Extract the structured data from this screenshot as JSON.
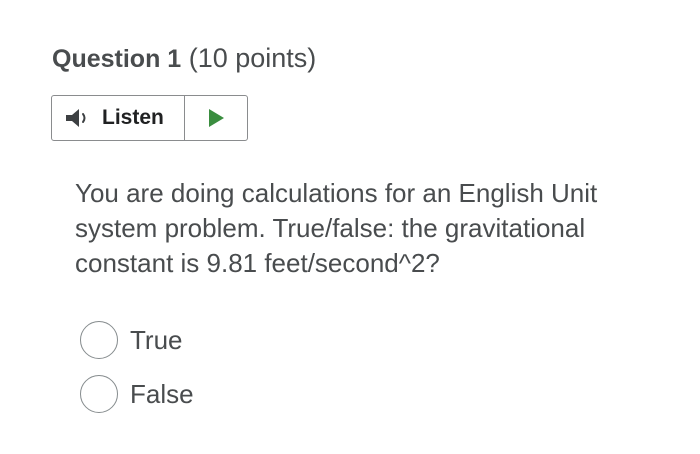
{
  "question": {
    "title": "Question 1",
    "points": "(10 points)",
    "text": "You are doing calculations for an English Unit system problem. True/false: the gravitational constant is 9.81 feet/second^2?"
  },
  "listen": {
    "label": "Listen",
    "speaker_icon": "speaker-icon",
    "play_icon": "play-icon",
    "play_color": "#3a8d3f"
  },
  "choices": [
    {
      "label": "True",
      "selected": false
    },
    {
      "label": "False",
      "selected": false
    }
  ]
}
